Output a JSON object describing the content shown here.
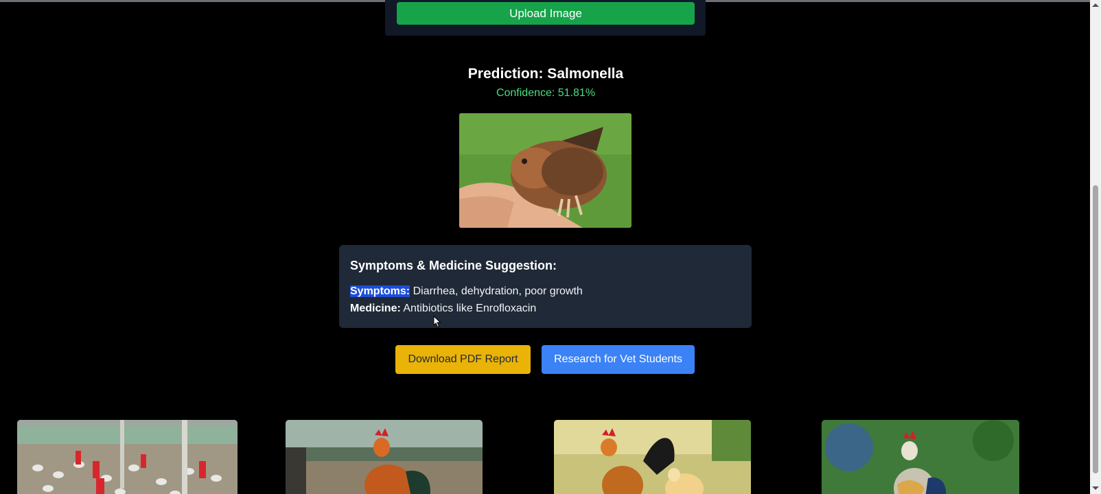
{
  "upload": {
    "button_label": "Upload Image"
  },
  "prediction": {
    "title": "Prediction: Salmonella",
    "confidence": "Confidence: 51.81%"
  },
  "suggestion": {
    "heading": "Symptoms & Medicine Suggestion:",
    "symptoms_label": "Symptoms:",
    "symptoms_value": "Diarrhea, dehydration, poor growth",
    "medicine_label": "Medicine:",
    "medicine_value": "Antibiotics like Enrofloxacin"
  },
  "actions": {
    "download_label": "Download PDF Report",
    "research_label": "Research for Vet Students"
  },
  "colors": {
    "upload_button": "#16a34a",
    "confidence_text": "#4ade80",
    "card_background": "#1f2937",
    "download_button": "#eab308",
    "research_button": "#3b82f6"
  }
}
